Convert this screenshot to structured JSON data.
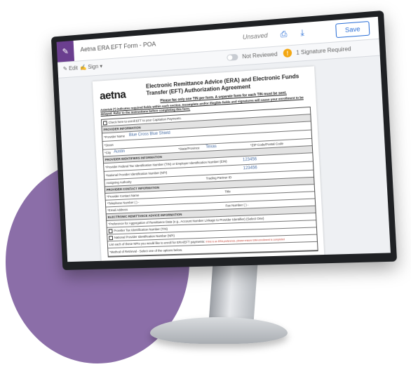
{
  "app": {
    "title": "Aetna ERA EFT Form - POA",
    "status": "Unsaved",
    "save_label": "Save",
    "edit_label": "Edit",
    "sign_label": "Sign",
    "review_label": "Not Reviewed",
    "signature_label": "1 Signature Required",
    "warn_glyph": "!"
  },
  "form": {
    "logo": "aetna",
    "title": "Electronic Remittance Advice (ERA) and Electronic Funds Transfer (EFT) Authorization Agreement",
    "subtitle": "Please fax only one TIN per form. A separate form for each TIN must be sent.",
    "instructions": "Asterisk (*) indicates required fields within each section. Incomplete and/or illegible fields and signatures will cause your enrollment to be delayed. Refer to the instructions before completing this form.",
    "capitation_check": "Check here to enroll EFT to your Capitation Payments.",
    "sections": {
      "provider_info": "PROVIDER INFORMATION",
      "identifiers": "PROVIDER IDENTIFIERS INFORMATION",
      "contact": "PROVIDER CONTACT INFORMATION",
      "era": "ELECTRONIC REMITTANCE ADVICE INFORMATION"
    },
    "labels": {
      "provider_name": "*Provider Name",
      "street": "*Street",
      "city": "*City",
      "state": "*State/Province",
      "zip": "*ZIP Code/Postal Code",
      "tin": "*Provider Federal Tax Identification Number (TIN) or Employer Identification Number (EIN)",
      "npi": "*National Provider Identification Number (NPI)",
      "assigning": "Assigning Authority",
      "trading": "Trading Partner ID",
      "contact_name": "*Provider Contact Name",
      "title": "Title",
      "phone": "*Telephone Number (     )       -",
      "email": "*Email Address",
      "fax": "Fax Number (     )       -",
      "aggregation": "*Preference for Aggregation of Remittance Data (e.g., Account Number Linkage to Provider Identifier) (Select One)",
      "opt_tin": "Provider Tax Identification Number (TIN)",
      "opt_npi": "National Provider Identification Number (NPI)",
      "opt_note": "List each of these NPIs you would like to enroll for ERA/EFT payments:",
      "red_note": "If this is an ERA preference, please ensure ERA enrollment is completed",
      "retrieval": "*Method of Retrieval - Select one of the options below."
    },
    "values": {
      "provider_name": "Blue Cross Blue Shield",
      "city": "Austin",
      "state": "Texas",
      "tin": "123456",
      "npi": "123456"
    }
  }
}
